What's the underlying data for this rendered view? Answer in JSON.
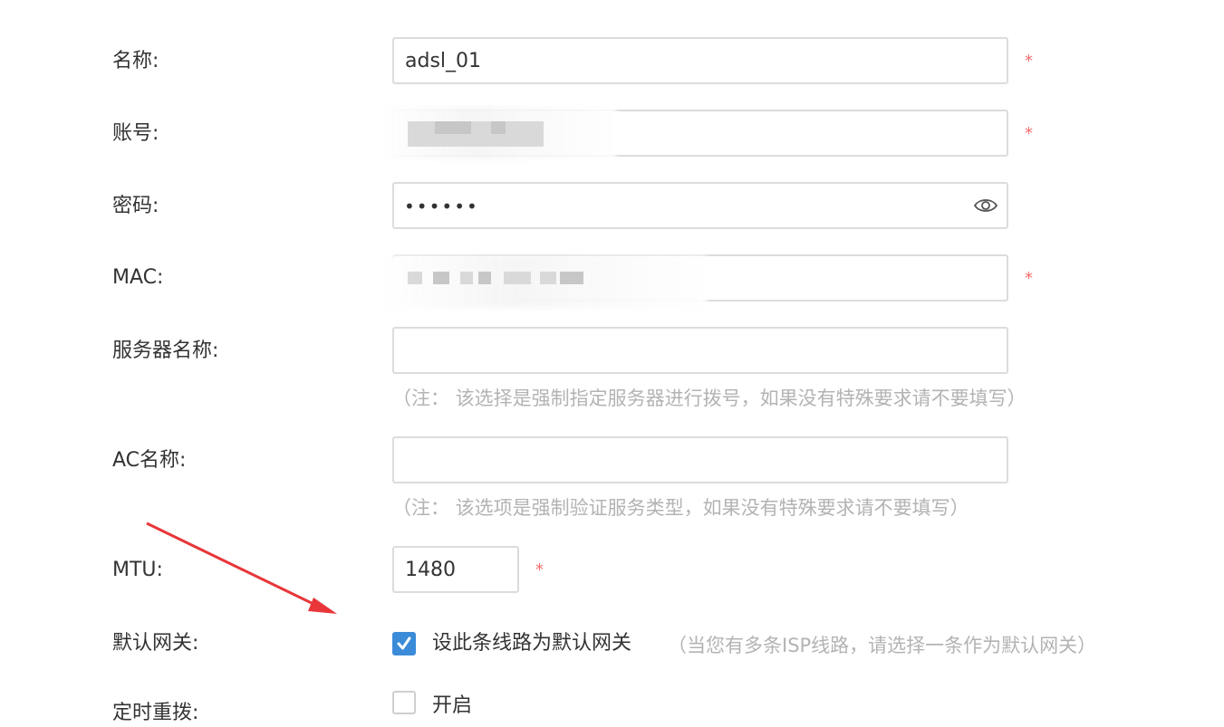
{
  "form": {
    "name": {
      "label": "名称:",
      "value": "adsl_01",
      "required": "*"
    },
    "account": {
      "label": "账号:",
      "value": "",
      "required": "*"
    },
    "password": {
      "label": "密码:",
      "masked_value": "••••••"
    },
    "mac": {
      "label": "MAC:",
      "value": "",
      "required": "*"
    },
    "server_name": {
      "label": "服务器名称:",
      "value": "",
      "hint": "（注： 该选择是强制指定服务器进行拨号，如果没有特殊要求请不要填写）"
    },
    "ac_name": {
      "label": "AC名称:",
      "value": "",
      "hint": "（注： 该选项是强制验证服务类型，如果没有特殊要求请不要填写）"
    },
    "mtu": {
      "label": "MTU:",
      "value": "1480",
      "required": "*"
    },
    "default_gateway": {
      "label": "默认网关:",
      "checkbox_label": "设此条线路为默认网关",
      "checked": true,
      "hint": "（当您有多条ISP线路，请选择一条作为默认网关）"
    },
    "scheduled_redial": {
      "label": "定时重拨:",
      "checkbox_label": "开启",
      "checked": false
    }
  },
  "icons": {
    "password_toggle": "eye-icon",
    "checkmark": "check-icon"
  },
  "colors": {
    "required": "#f56c6c",
    "checkbox_checked": "#3b8bd9",
    "hint_text": "#b3b3b3",
    "annotation_arrow": "#e8363a"
  }
}
